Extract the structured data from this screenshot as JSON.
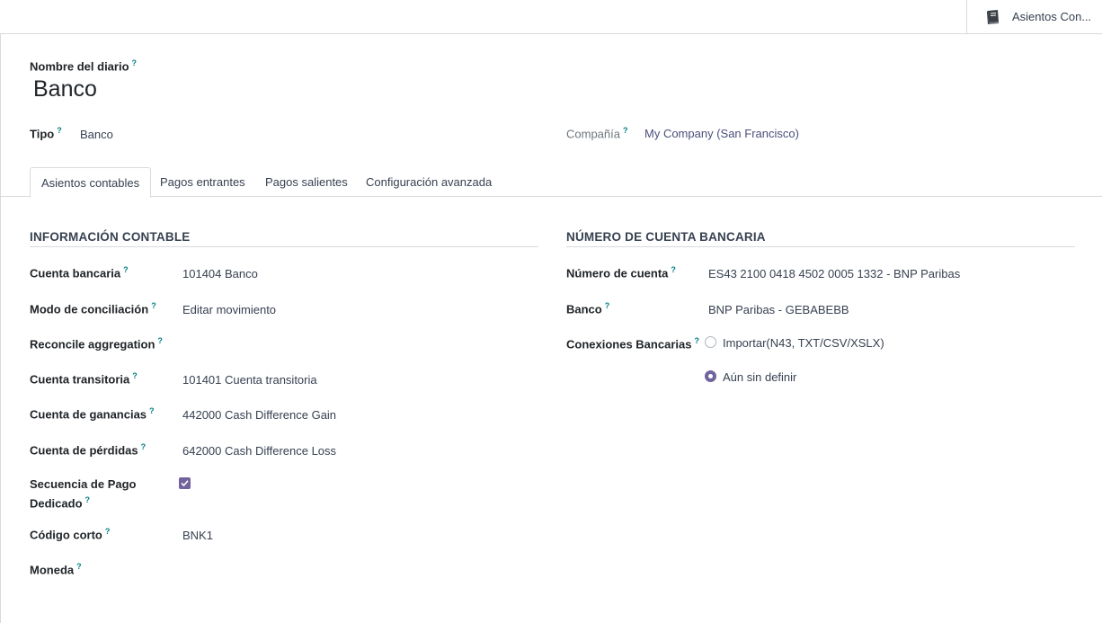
{
  "smart_button": {
    "label": "Asientos Con...",
    "icon": "book-icon"
  },
  "header": {
    "journal_name_label": "Nombre del diario",
    "journal_name": "Banco",
    "type_label": "Tipo",
    "type_value": "Banco",
    "company_label": "Compañía",
    "company_value": "My Company (San Francisco)"
  },
  "tabs": [
    {
      "label": "Asientos contables",
      "active": true
    },
    {
      "label": "Pagos entrantes"
    },
    {
      "label": "Pagos salientes"
    },
    {
      "label": "Configuración avanzada"
    }
  ],
  "accounting": {
    "title": "INFORMACIÓN CONTABLE",
    "fields": [
      {
        "label": "Cuenta bancaria",
        "value": "101404 Banco"
      },
      {
        "label": "Modo de conciliación",
        "value": "Editar movimiento"
      },
      {
        "label": "Reconcile aggregation",
        "value": ""
      },
      {
        "label": "Cuenta transitoria",
        "value": "101401 Cuenta transitoria"
      },
      {
        "label": "Cuenta de ganancias",
        "value": "442000 Cash Difference Gain"
      },
      {
        "label": "Cuenta de pérdidas",
        "value": "642000 Cash Difference Loss"
      },
      {
        "label_line1": "Secuencia de Pago",
        "label_line2": "Dedicado",
        "checked": true
      },
      {
        "label": "Código corto",
        "value": "BNK1"
      },
      {
        "label": "Moneda",
        "value": ""
      }
    ]
  },
  "bank_account": {
    "title": "NÚMERO DE CUENTA BANCARIA",
    "account_label": "Número de cuenta",
    "account_value": "ES43 2100 0418 4502 0005 1332 - BNP Paribas",
    "bank_label": "Banco",
    "bank_value": "BNP Paribas - GEBABEBB",
    "connections_label": "Conexiones Bancarias",
    "options": [
      {
        "label": "Importar(N43, TXT/CSV/XSLX)",
        "selected": false
      },
      {
        "label": "Aún sin definir",
        "selected": true
      }
    ]
  },
  "help_mark": "?",
  "colors": {
    "accent": "#71639e",
    "help": "#017e84",
    "border": "#d8dadd"
  }
}
